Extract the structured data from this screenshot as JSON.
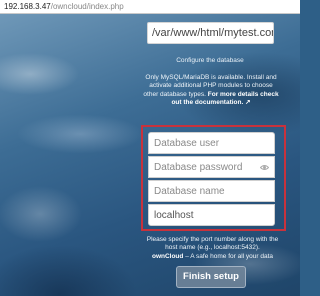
{
  "browser": {
    "url_host": "192.168.3.47",
    "url_path": "/owncloud/index.php"
  },
  "data_folder": {
    "value": "/var/www/html/mytest.com/"
  },
  "database": {
    "configure_label": "Configure the database",
    "info_text": "Only MySQL/MariaDB is available. Install and activate additional PHP modules to choose other database types.",
    "info_link": "For more details check out the documentation. ↗",
    "user_placeholder": "Database user",
    "password_placeholder": "Database password",
    "name_placeholder": "Database name",
    "host_value": "localhost",
    "port_hint": "Please specify the port number along with the host name (e.g., localhost:5432).",
    "tagline_brand": "ownCloud",
    "tagline_text": " – A safe home for all your data"
  },
  "actions": {
    "finish_label": "Finish setup"
  },
  "icons": {
    "password_toggle": "eye-icon"
  },
  "colors": {
    "highlight_border": "#c8323c"
  }
}
